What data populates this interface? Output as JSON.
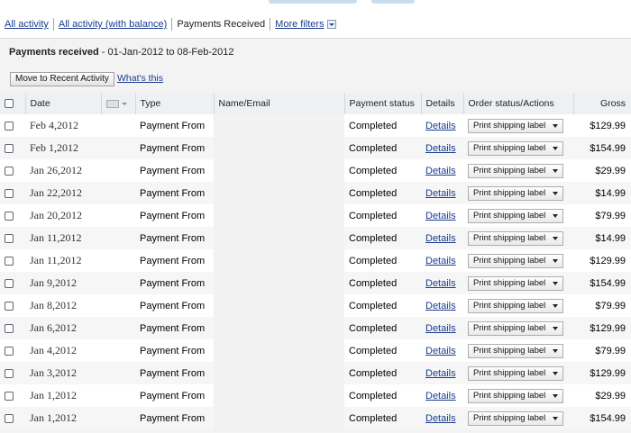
{
  "filters": {
    "all_activity": "All activity",
    "all_activity_balance": "All activity (with balance)",
    "payments_received": "Payments Received",
    "more_filters": "More filters"
  },
  "panel": {
    "title_bold": "Payments received",
    "title_range": " - 01-Jan-2012 to 08-Feb-2012",
    "move_button": "Move to Recent Activity",
    "whats_this": "What's this"
  },
  "table": {
    "headers": {
      "date": "Date",
      "type": "Type",
      "name_email": "Name/Email",
      "payment_status": "Payment status",
      "details": "Details",
      "order_status": "Order status/Actions",
      "gross": "Gross"
    },
    "rows": [
      {
        "date": "Feb 4,2012",
        "type": "Payment From",
        "status": "Completed",
        "details": "Details",
        "action": "Print shipping label",
        "gross": "$129.99"
      },
      {
        "date": "Feb 1,2012",
        "type": "Payment From",
        "status": "Completed",
        "details": "Details",
        "action": "Print shipping label",
        "gross": "$154.99"
      },
      {
        "date": "Jan 26,2012",
        "type": "Payment From",
        "status": "Completed",
        "details": "Details",
        "action": "Print shipping label",
        "gross": "$29.99"
      },
      {
        "date": "Jan 22,2012",
        "type": "Payment From",
        "status": "Completed",
        "details": "Details",
        "action": "Print shipping label",
        "gross": "$14.99"
      },
      {
        "date": "Jan 20,2012",
        "type": "Payment From",
        "status": "Completed",
        "details": "Details",
        "action": "Print shipping label",
        "gross": "$79.99"
      },
      {
        "date": "Jan 11,2012",
        "type": "Payment From",
        "status": "Completed",
        "details": "Details",
        "action": "Print shipping label",
        "gross": "$14.99"
      },
      {
        "date": "Jan 11,2012",
        "type": "Payment From",
        "status": "Completed",
        "details": "Details",
        "action": "Print shipping label",
        "gross": "$129.99"
      },
      {
        "date": "Jan 9,2012",
        "type": "Payment From",
        "status": "Completed",
        "details": "Details",
        "action": "Print shipping label",
        "gross": "$154.99"
      },
      {
        "date": "Jan 8,2012",
        "type": "Payment From",
        "status": "Completed",
        "details": "Details",
        "action": "Print shipping label",
        "gross": "$79.99"
      },
      {
        "date": "Jan 6,2012",
        "type": "Payment From",
        "status": "Completed",
        "details": "Details",
        "action": "Print shipping label",
        "gross": "$129.99"
      },
      {
        "date": "Jan 4,2012",
        "type": "Payment From",
        "status": "Completed",
        "details": "Details",
        "action": "Print shipping label",
        "gross": "$79.99"
      },
      {
        "date": "Jan 3,2012",
        "type": "Payment From",
        "status": "Completed",
        "details": "Details",
        "action": "Print shipping label",
        "gross": "$129.99"
      },
      {
        "date": "Jan 1,2012",
        "type": "Payment From",
        "status": "Completed",
        "details": "Details",
        "action": "Print shipping label",
        "gross": "$29.99"
      },
      {
        "date": "Jan 1,2012",
        "type": "Payment From",
        "status": "Completed",
        "details": "Details",
        "action": "Print shipping label",
        "gross": "$154.99"
      }
    ]
  },
  "icons": {
    "checkbox": "checkbox-icon",
    "flag": "flag-icon",
    "dropdown": "chevron-down-icon"
  },
  "colors": {
    "link": "#1a3c8f",
    "header_bg": "#eef0f2",
    "panel_bg": "#f3f3f3"
  }
}
